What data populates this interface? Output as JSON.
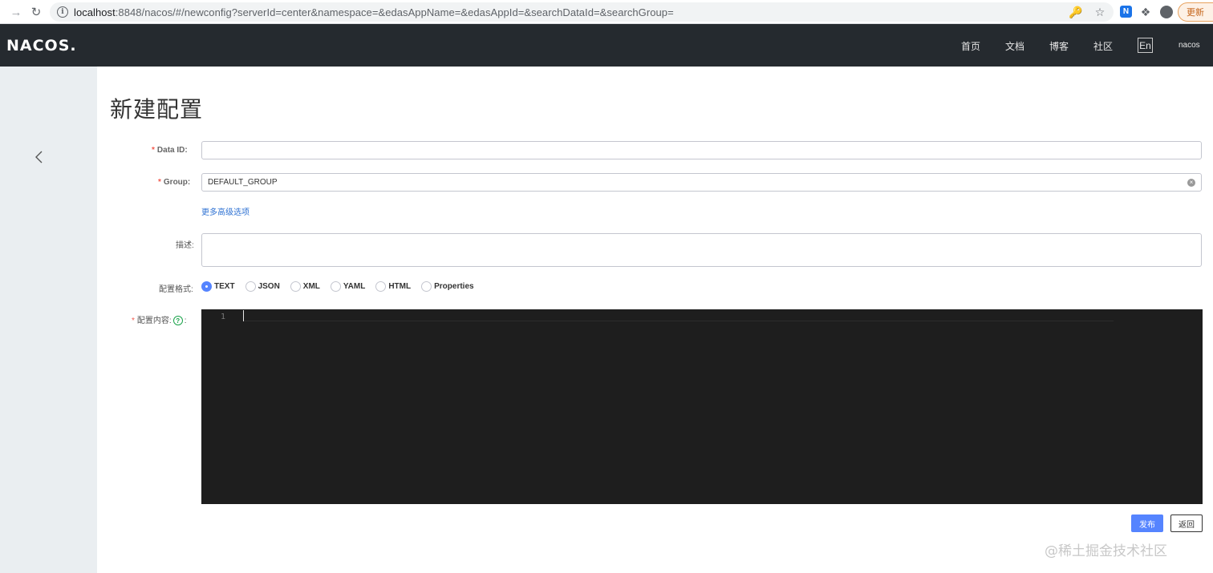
{
  "browser": {
    "url_host": "localhost",
    "url_rest": ":8848/nacos/#/newconfig?serverId=center&namespace=&edasAppName=&edasAppId=&searchDataId=&searchGroup=",
    "update_label": "更新"
  },
  "header": {
    "logo": "NACOS.",
    "nav": [
      "首页",
      "文档",
      "博客",
      "社区"
    ],
    "lang": "En",
    "user": "nacos"
  },
  "page": {
    "title": "新建配置"
  },
  "form": {
    "data_id_label": "Data ID:",
    "data_id_value": "",
    "group_label": "Group:",
    "group_value": "DEFAULT_GROUP",
    "advanced_link": "更多高级选项",
    "desc_label": "描述:",
    "desc_value": "",
    "format_label": "配置格式:",
    "formats": [
      "TEXT",
      "JSON",
      "XML",
      "YAML",
      "HTML",
      "Properties"
    ],
    "selected_format": "TEXT",
    "content_label": "配置内容:",
    "content_label_colon": ":",
    "editor_line": "1"
  },
  "actions": {
    "publish": "发布",
    "back": "返回"
  },
  "watermark": "@稀土掘金技术社区",
  "colors": {
    "header_bg": "#252a2f",
    "primary": "#5584ff",
    "link": "#2f72d3",
    "required": "#f25b4f",
    "editor_bg": "#1e1e1e",
    "sidebar_bg": "#eaeef1"
  }
}
